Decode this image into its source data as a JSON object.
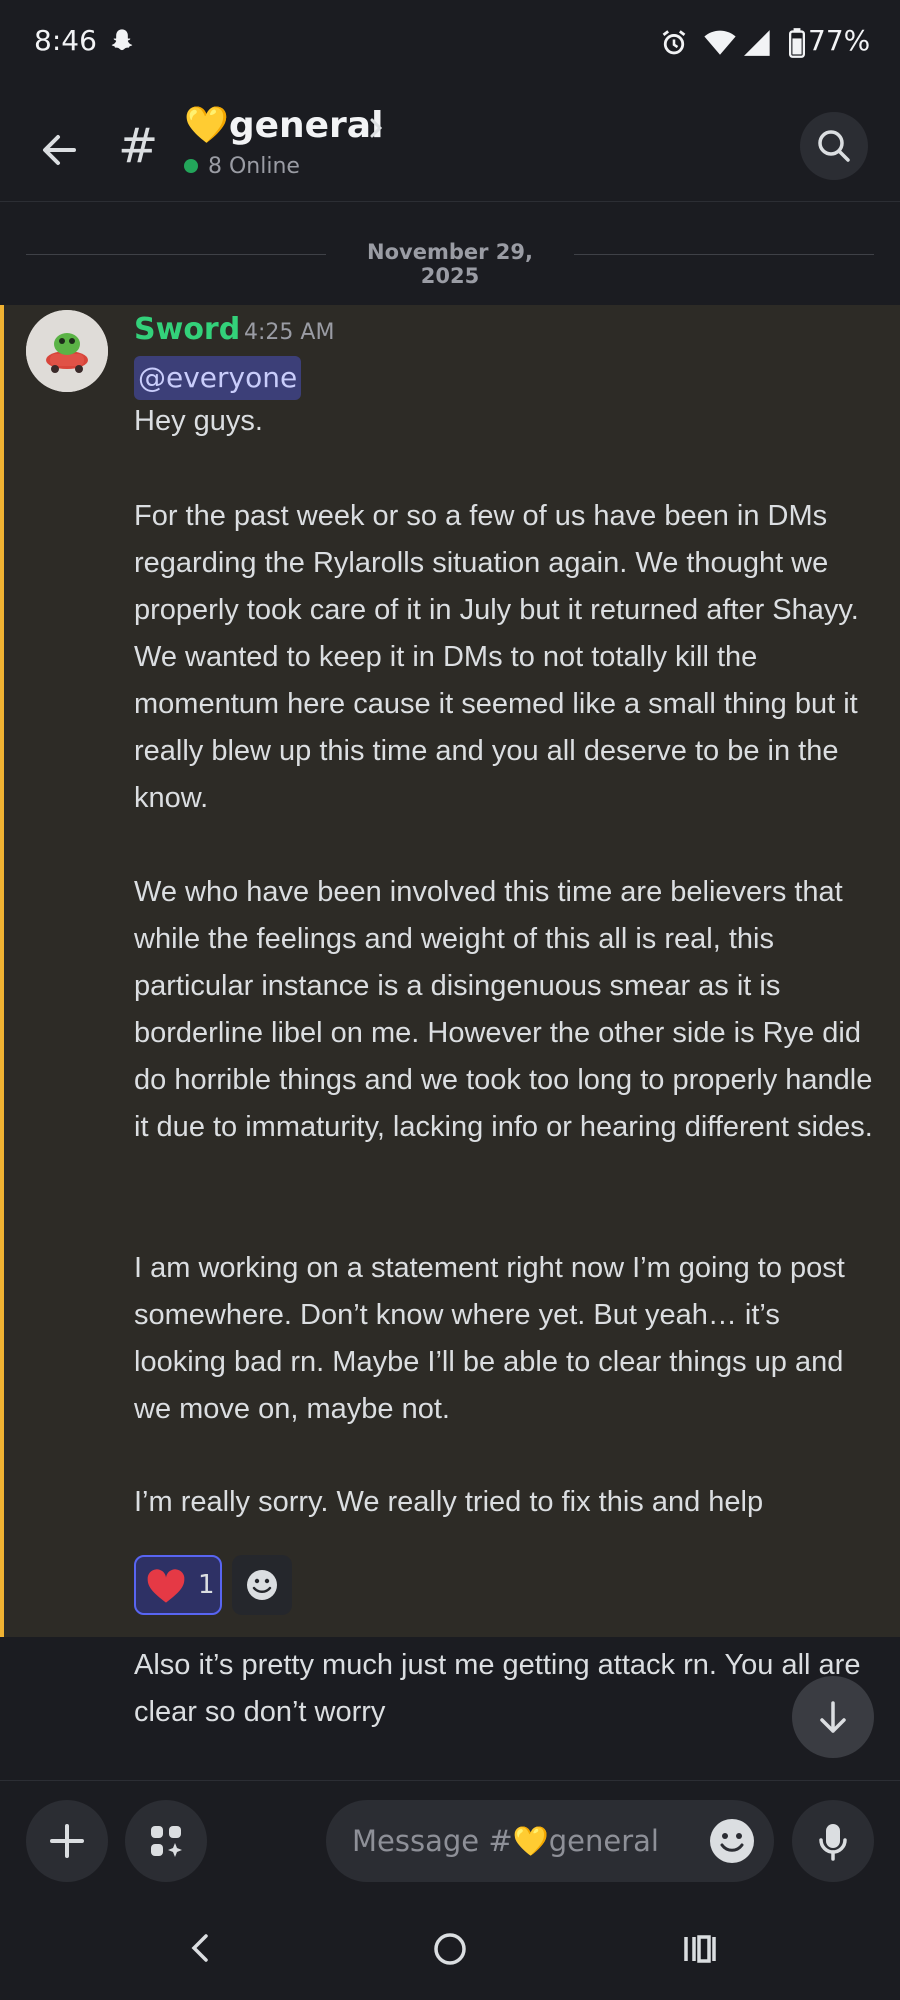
{
  "status_bar": {
    "time": "8:46",
    "battery": "77%"
  },
  "header": {
    "channel_name": "💛general",
    "online_text": "8 Online"
  },
  "date_divider": "November 29, 2025",
  "message": {
    "author": "Sword",
    "author_color": "#33d17a",
    "timestamp": "4:25 AM",
    "mention": "@everyone",
    "paragraphs": [
      "Hey guys.",
      "For the past week or so a few of us have been in DMs regarding the Rylarolls situation again. We thought we properly took care of it in July but it returned after Shayy. We wanted to keep it in DMs to not totally kill the momentum here cause it seemed like a small thing but it really blew up this time and you all deserve to be in the know.",
      "We who have been involved this time are believers that while the feelings and weight of this all is real, this particular instance is a disingenuous smear as it is borderline libel on me. However the other side is Rye did do horrible things and we took too long to properly handle it due to immaturity, lacking info or hearing different sides.",
      "I am working on a statement right now I’m going to post somewhere. Don’t know where yet. But yeah… it’s looking bad rn. Maybe I’ll be able to clear things up and we move on, maybe not.",
      "I’m really sorry. We really tried to fix this and help"
    ],
    "reactions": [
      {
        "emoji": "heart",
        "count": "1"
      }
    ]
  },
  "followup_message": "Also it’s pretty much just me getting attack rn. You all are clear so don’t worry",
  "composer": {
    "placeholder": "Message #💛general"
  },
  "colors": {
    "mention_highlight_bar": "#f0b232",
    "accent": "#5865f2",
    "online": "#23a55a"
  },
  "icons": [
    "snapchat-icon",
    "alarm-icon",
    "wifi-icon",
    "signal-icon",
    "battery-icon",
    "back-arrow-icon",
    "hash-icon",
    "chevron-right-icon",
    "search-icon",
    "heart-icon",
    "add-reaction-icon",
    "arrow-down-icon",
    "plus-icon",
    "apps-icon",
    "emoji-icon",
    "mic-icon",
    "nav-back-icon",
    "nav-home-icon",
    "nav-recents-icon"
  ]
}
